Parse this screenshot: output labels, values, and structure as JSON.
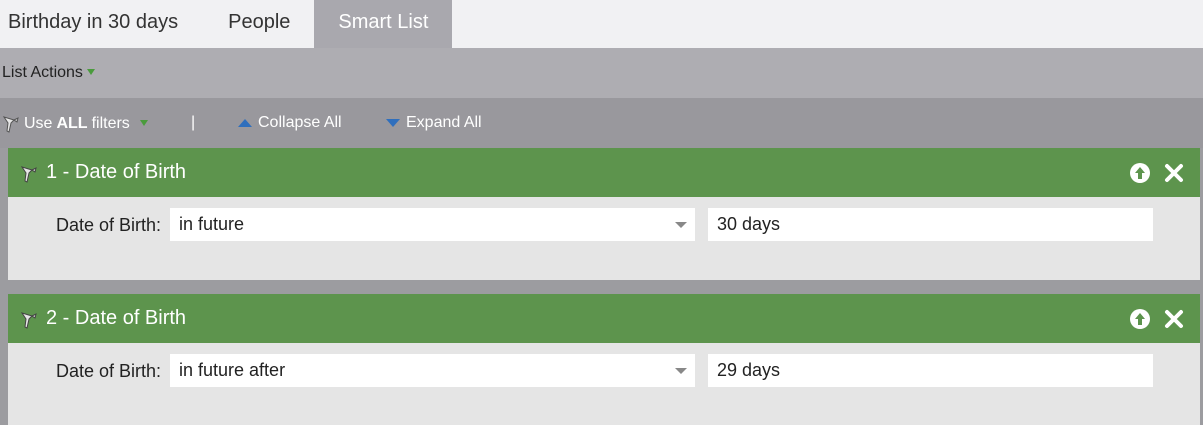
{
  "tabs": [
    {
      "label": "Birthday in 30 days",
      "active": false
    },
    {
      "label": "People",
      "active": false
    },
    {
      "label": "Smart List",
      "active": true
    }
  ],
  "actions": {
    "list_actions_label": "List Actions"
  },
  "filter_bar": {
    "use_prefix": "Use",
    "use_bold": "ALL",
    "use_suffix": "filters",
    "separator": "|",
    "collapse_label": "Collapse All",
    "expand_label": "Expand All"
  },
  "filters": [
    {
      "title": "1 - Date of Birth",
      "field_label": "Date of Birth:",
      "operator": "in future",
      "value": "30 days"
    },
    {
      "title": "2 - Date of Birth",
      "field_label": "Date of Birth:",
      "operator": "in future after",
      "value": "29 days"
    }
  ],
  "colors": {
    "header_green": "#5d944d",
    "active_tab": "#a9a8ae",
    "accent_blue": "#2f6fbd"
  },
  "icons": [
    "funnel-icon",
    "caret-down-icon",
    "collapse-icon",
    "expand-icon",
    "move-up-icon",
    "close-icon",
    "dropdown-arrow-icon"
  ]
}
